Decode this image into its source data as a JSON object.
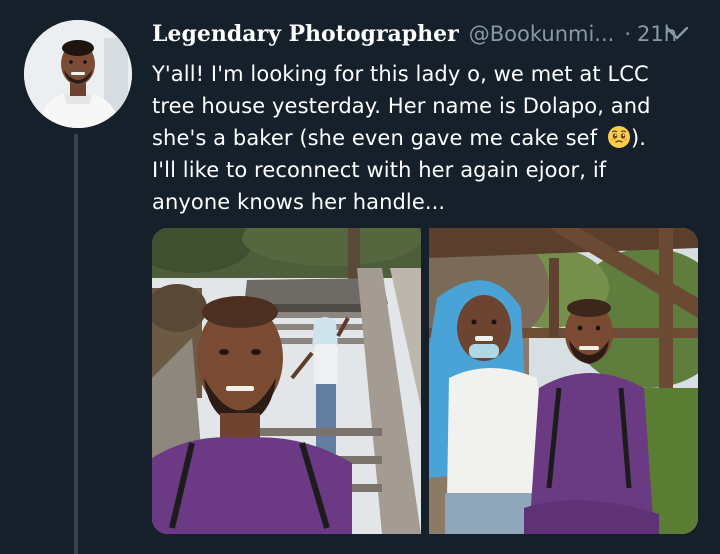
{
  "tweet": {
    "display_name": "Legendary Photographer",
    "handle": "@Bookunmi...",
    "separator": "·",
    "timestamp": "21h",
    "text_before_emoji": "Y'all! I'm looking for this lady o, we met at LCC\ntree house yesterday. Her name is Dolapo, and\nshe's a baker (she even gave me cake sef ",
    "text_after_emoji": ").\nI'll like to reconnect with her again ejoor, if\nanyone knows her handle...",
    "emoji": "pleading-face-emoji",
    "avatar_icon": "profile-avatar"
  },
  "media": {
    "photos": [
      {
        "icon": "selfie-photo-treehouse-stairs"
      },
      {
        "icon": "photo-couple-treehouse"
      }
    ]
  },
  "colors": {
    "background": "#15202b",
    "secondary_text": "#8899a6",
    "thread_line": "#38444d"
  }
}
